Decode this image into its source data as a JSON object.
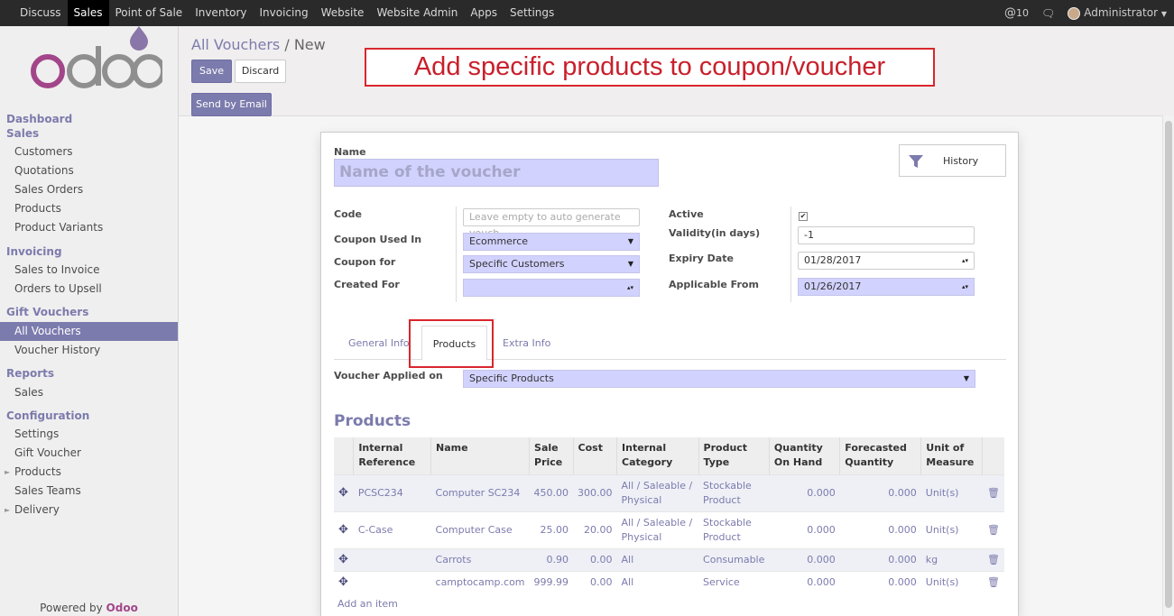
{
  "topbar": {
    "menu": [
      "Discuss",
      "Sales",
      "Point of Sale",
      "Inventory",
      "Invoicing",
      "Website",
      "Website Admin",
      "Apps",
      "Settings"
    ],
    "active": "Sales",
    "mentions": "10",
    "user": "Administrator"
  },
  "sidebar": {
    "sections": [
      {
        "title": "Dashboard"
      },
      {
        "title": "Sales",
        "items": [
          "Customers",
          "Quotations",
          "Sales Orders",
          "Products",
          "Product Variants"
        ]
      },
      {
        "title": "Invoicing",
        "items": [
          "Sales to Invoice",
          "Orders to Upsell"
        ]
      },
      {
        "title": "Gift Vouchers",
        "items": [
          "All Vouchers",
          "Voucher History"
        ]
      },
      {
        "title": "Reports",
        "items": [
          "Sales"
        ]
      },
      {
        "title": "Configuration",
        "items": [
          "Settings",
          "Gift Voucher",
          "Products",
          "Sales Teams",
          "Delivery"
        ]
      }
    ],
    "active_item": "All Vouchers",
    "powered_prefix": "Powered by ",
    "powered_brand": "Odoo"
  },
  "breadcrumb": {
    "parent": "All Vouchers",
    "separator": "/",
    "current": "New"
  },
  "buttons": {
    "save": "Save",
    "discard": "Discard",
    "send_email": "Send by Email"
  },
  "annotation": "Add specific products to coupon/voucher",
  "form": {
    "name_label": "Name",
    "name_placeholder": "Name of the voucher",
    "history": "History",
    "code_label": "Code",
    "code_placeholder": "Leave empty to auto generate vouch",
    "coupon_used_in_label": "Coupon Used In",
    "coupon_used_in": "Ecommerce",
    "coupon_for_label": "Coupon for",
    "coupon_for": "Specific Customers",
    "created_for_label": "Created For",
    "created_for": "",
    "active_label": "Active",
    "active_checked": true,
    "validity_label": "Validity(in days)",
    "validity": "-1",
    "expiry_label": "Expiry Date",
    "expiry": "01/28/2017",
    "applicable_label": "Applicable From",
    "applicable": "01/26/2017"
  },
  "tabs": [
    "General Info",
    "Products",
    "Extra Info"
  ],
  "active_tab": "Products",
  "applied_on_label": "Voucher Applied on",
  "applied_on": "Specific Products",
  "products_title": "Products",
  "table": {
    "headers": [
      "Internal Reference",
      "Name",
      "Sale Price",
      "Cost",
      "Internal Category",
      "Product Type",
      "Quantity On Hand",
      "Forecasted Quantity",
      "Unit of Measure"
    ],
    "rows": [
      {
        "ref": "PCSC234",
        "name": "Computer SC234",
        "price": "450.00",
        "cost": "300.00",
        "category": "All / Saleable / Physical",
        "type": "Stockable Product",
        "qty": "0.000",
        "forecast": "0.000",
        "uom": "Unit(s)"
      },
      {
        "ref": "C-Case",
        "name": "Computer Case",
        "price": "25.00",
        "cost": "20.00",
        "category": "All / Saleable / Physical",
        "type": "Stockable Product",
        "qty": "0.000",
        "forecast": "0.000",
        "uom": "Unit(s)"
      },
      {
        "ref": "",
        "name": "Carrots",
        "price": "0.90",
        "cost": "0.00",
        "category": "All",
        "type": "Consumable",
        "qty": "0.000",
        "forecast": "0.000",
        "uom": "kg"
      },
      {
        "ref": "",
        "name": "camptocamp.com",
        "price": "999.99",
        "cost": "0.00",
        "category": "All",
        "type": "Service",
        "qty": "0.000",
        "forecast": "0.000",
        "uom": "Unit(s)"
      }
    ],
    "add_item": "Add an item"
  },
  "colors": {
    "brand": "#7c7bad",
    "annotation": "#d9262e",
    "topbar": "#2a2a2a"
  }
}
